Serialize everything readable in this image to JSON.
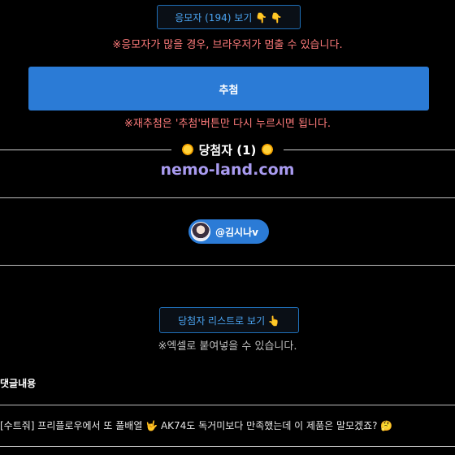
{
  "view_applicants_button": {
    "label": "응모자 (194) 보기 👇 👇"
  },
  "warning_browser": "※응모자가 많을 경우, 브라우저가 멈출 수 있습니다.",
  "draw_button": {
    "label": "추첨"
  },
  "warning_redraw": "※재추첨은 '추첨'버튼만 다시 누르시면 됩니다.",
  "winners": {
    "title": "당첨자 (1)",
    "site": "nemo-land.com",
    "list": [
      {
        "name": "@김시나v"
      }
    ]
  },
  "winner_list_button": {
    "label": "당첨자 리스트로 보기 👆"
  },
  "excel_note": "※엑셀로 붙여넣을 수 있습니다.",
  "comments": {
    "label": "댓글내용",
    "items": [
      "[수트줘] 프리플로우에서 또 풀배열 🤟 AK74도 독거미보다 만족했는데 이 제품은 말모겠죠? 🤔"
    ]
  }
}
